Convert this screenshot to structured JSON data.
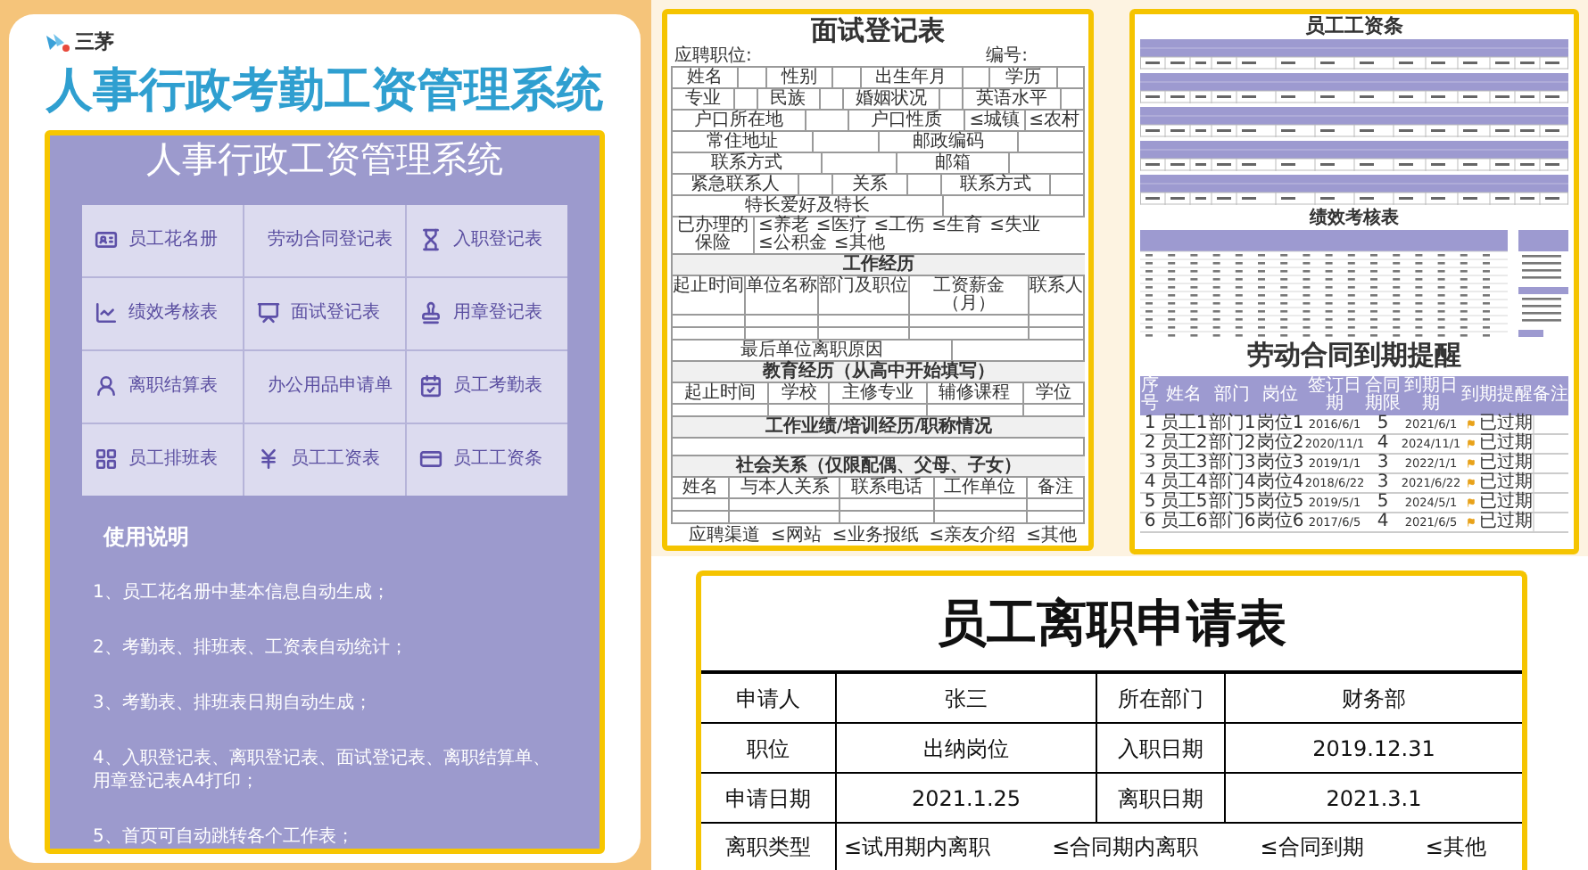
{
  "left_card": {
    "logo": "三茅",
    "title": "人事行政考勤工资管理系统",
    "panel_title": "人事行政工资管理系统",
    "menu": [
      {
        "label": "员工花名册"
      },
      {
        "label": "劳动合同登记表"
      },
      {
        "label": "入职登记表"
      },
      {
        "label": "绩效考核表"
      },
      {
        "label": "面试登记表"
      },
      {
        "label": "用章登记表"
      },
      {
        "label": "离职结算表"
      },
      {
        "label": "办公用品申请单"
      },
      {
        "label": "员工考勤表"
      },
      {
        "label": "员工排班表"
      },
      {
        "label": "员工工资表"
      },
      {
        "label": "员工工资条"
      }
    ],
    "instructions_title": "使用说明",
    "instructions": [
      "1、员工花名册中基本信息自动生成；",
      "2、考勤表、排班表、工资表自动统计；",
      "3、考勤表、排班表日期自动生成；",
      "4、入职登记表、离职登记表、面试登记表、离职结算单、用章登记表A4打印；",
      "5、首页可自动跳转各个工作表；"
    ]
  },
  "interview_form": {
    "title": "面试登记表",
    "position_label": "应聘职位:",
    "number_label": "编号:",
    "rows": [
      {
        "kind": "cells",
        "cells": [
          {
            "kind": "label",
            "text": "姓名"
          },
          {
            "kind": "blank"
          },
          {
            "kind": "label",
            "text": "性别"
          },
          {
            "kind": "blank"
          },
          {
            "kind": "label",
            "text": "出生年月"
          },
          {
            "kind": "blank"
          },
          {
            "kind": "label",
            "text": "学历"
          },
          {
            "kind": "blank"
          }
        ]
      },
      {
        "kind": "cells",
        "cells": [
          {
            "kind": "label",
            "text": "专业"
          },
          {
            "kind": "blank"
          },
          {
            "kind": "label",
            "text": "民族"
          },
          {
            "kind": "blank"
          },
          {
            "kind": "label",
            "text": "婚姻状况"
          },
          {
            "kind": "blank"
          },
          {
            "kind": "label",
            "text": "英语水平"
          },
          {
            "kind": "blank"
          }
        ]
      },
      {
        "kind": "cells",
        "cells": [
          {
            "kind": "label",
            "text": "户口所在地"
          },
          {
            "kind": "blank"
          },
          {
            "kind": "label",
            "text": "户口性质"
          },
          {
            "kind": "option",
            "text": "≤城镇"
          },
          {
            "kind": "option",
            "text": "≤农村"
          }
        ]
      },
      {
        "kind": "cells",
        "cells": [
          {
            "kind": "label",
            "text": "常住地址"
          },
          {
            "kind": "blank"
          },
          {
            "kind": "label",
            "text": "邮政编码"
          },
          {
            "kind": "blank"
          }
        ]
      },
      {
        "kind": "cells",
        "cells": [
          {
            "kind": "label",
            "text": "联系方式"
          },
          {
            "kind": "blank"
          },
          {
            "kind": "label",
            "text": "邮箱"
          },
          {
            "kind": "blank"
          }
        ]
      },
      {
        "kind": "cells",
        "cells": [
          {
            "kind": "label",
            "text": "紧急联系人"
          },
          {
            "kind": "blank"
          },
          {
            "kind": "label",
            "text": "关系"
          },
          {
            "kind": "blank"
          },
          {
            "kind": "label",
            "text": "联系方式"
          },
          {
            "kind": "blank"
          }
        ]
      },
      {
        "kind": "cells",
        "cells": [
          {
            "kind": "label",
            "text": "特长爱好及特长"
          },
          {
            "kind": "blank"
          }
        ]
      },
      {
        "kind": "cells",
        "cells": [
          {
            "kind": "label",
            "text": "已办理的保险"
          },
          {
            "kind": "option",
            "text": "≤养老"
          },
          {
            "kind": "option",
            "text": "≤医疗"
          },
          {
            "kind": "option",
            "text": "≤工伤"
          },
          {
            "kind": "option",
            "text": "≤生育"
          },
          {
            "kind": "option",
            "text": "≤失业"
          },
          {
            "kind": "option",
            "text": "≤公积金"
          },
          {
            "kind": "option",
            "text": "≤其他"
          }
        ]
      },
      {
        "kind": "section",
        "text": "工作经历"
      },
      {
        "kind": "columns",
        "cells": [
          "起止时间",
          "单位名称",
          "部门及职位",
          "工资薪金（月）",
          "联系人"
        ]
      },
      {
        "kind": "blank_row"
      },
      {
        "kind": "blank_row"
      },
      {
        "kind": "cells",
        "cells": [
          {
            "kind": "label",
            "text": "最后单位离职原因"
          },
          {
            "kind": "blank"
          }
        ]
      },
      {
        "kind": "section",
        "text": "教育经历（从高中开始填写）"
      },
      {
        "kind": "columns",
        "cells": [
          "起止时间",
          "学校",
          "主修专业",
          "辅修课程",
          "学位"
        ]
      },
      {
        "kind": "blank_row"
      },
      {
        "kind": "section",
        "text": "工作业绩/培训经历/职称情况"
      },
      {
        "kind": "blank_area"
      },
      {
        "kind": "section",
        "text": "社会关系（仅限配偶、父母、子女）"
      },
      {
        "kind": "columns",
        "cells": [
          "姓名",
          "与本人关系",
          "联系电话",
          "工作单位",
          "备注"
        ]
      },
      {
        "kind": "blank_row"
      },
      {
        "kind": "blank_row"
      },
      {
        "kind": "footer",
        "cells": [
          "应聘渠道",
          "≤网站",
          "≤业务报纸",
          "≤亲友介绍",
          "≤其他"
        ]
      }
    ]
  },
  "salary_slips": {
    "title": "员工工资条"
  },
  "performance": {
    "title": "绩效考核表"
  },
  "contracts": {
    "title": "劳动合同到期提醒",
    "columns": [
      "序号",
      "姓名",
      "部门",
      "岗位",
      "签订日期",
      "合同期限",
      "到期日期",
      "到期提醒",
      "备注"
    ],
    "rows": [
      {
        "cells": [
          "1",
          "员工1",
          "部门1",
          "岗位1",
          "2016/6/1",
          "5",
          "2021/6/1"
        ],
        "reminder": "已过期"
      },
      {
        "cells": [
          "2",
          "员工2",
          "部门2",
          "岗位2",
          "2020/11/1",
          "4",
          "2024/11/1"
        ],
        "reminder": "已过期"
      },
      {
        "cells": [
          "3",
          "员工3",
          "部门3",
          "岗位3",
          "2019/1/1",
          "3",
          "2022/1/1"
        ],
        "reminder": "已过期"
      },
      {
        "cells": [
          "4",
          "员工4",
          "部门4",
          "岗位4",
          "2018/6/22",
          "3",
          "2021/6/22"
        ],
        "reminder": "已过期"
      },
      {
        "cells": [
          "5",
          "员工5",
          "部门5",
          "岗位5",
          "2019/5/1",
          "5",
          "2024/5/1"
        ],
        "reminder": "已过期"
      },
      {
        "cells": [
          "6",
          "员工6",
          "部门6",
          "岗位6",
          "2017/6/5",
          "4",
          "2021/6/5"
        ],
        "reminder": "已过期"
      }
    ]
  },
  "resignation_form": {
    "title": "员工离职申请表",
    "rows": [
      [
        "申请人",
        "张三",
        "所在部门",
        "财务部"
      ],
      [
        "职位",
        "出纳岗位",
        "入职日期",
        "2019.12.31"
      ],
      [
        "申请日期",
        "2021.1.25",
        "离职日期",
        "2021.3.1"
      ]
    ],
    "type_label": "离职类型",
    "type_options": [
      "≤试用期内离职",
      "≤合同期内离职",
      "≤合同到期",
      "≤其他"
    ]
  }
}
